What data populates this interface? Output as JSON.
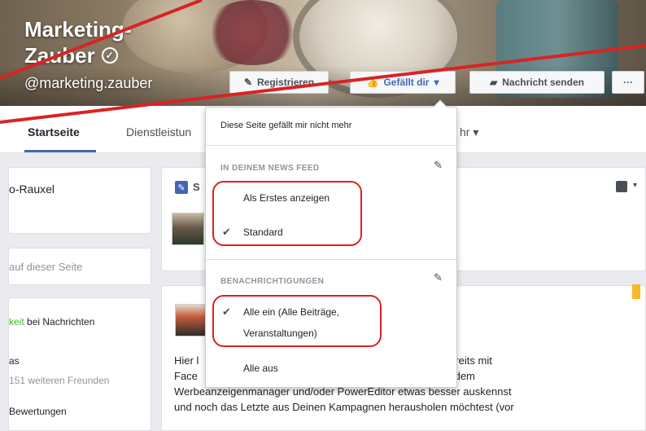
{
  "cover": {
    "name_line1": "Marketing-",
    "name_line2": "Zauber",
    "verified_symbol": "✓",
    "handle": "@marketing.zauber",
    "buttons": {
      "register": "Registrieren",
      "like": "Gefällt dir",
      "message": "Nachricht senden",
      "more": "···"
    }
  },
  "tabs": [
    {
      "label": "Startseite"
    },
    {
      "label": "Dienstleistun"
    },
    {
      "label": "hr ▾"
    }
  ],
  "left": {
    "card1_text": "o-Rauxel",
    "card2_placeholder": "auf dieser Seite",
    "card3": {
      "line1_green": "keit",
      "line1_rest": " bei Nachrichten",
      "line2": "as",
      "line3": "151 weiteren Freunden",
      "line4": "Bewertungen"
    }
  },
  "main": {
    "composer_label": "S",
    "post_body": [
      "Hier l                                                                    wenn Du bereits mit",
      "Face                                                                       schon mit dem",
      "Werbeanzeigenmanager und/oder PowerEditor etwas besser auskennst",
      "und noch das Letzte aus Deinen Kampagnen herausholen möchtest (vor"
    ]
  },
  "dropdown": {
    "unlike": "Diese Seite gefällt mir nicht mehr",
    "news_feed_header": "IN DEINEM NEWS FEED",
    "show_first": "Als Erstes anzeigen",
    "standard": "Standard",
    "notifications_header": "BENACHRICHTIGUNGEN",
    "all_on_line1": "Alle ein (Alle Beiträge,",
    "all_on_line2": "Veranstaltungen)",
    "all_off": "Alle aus"
  },
  "colors": {
    "fb_blue": "#4267b2",
    "annotation_red": "#d92323",
    "link_green": "#42b72a"
  }
}
